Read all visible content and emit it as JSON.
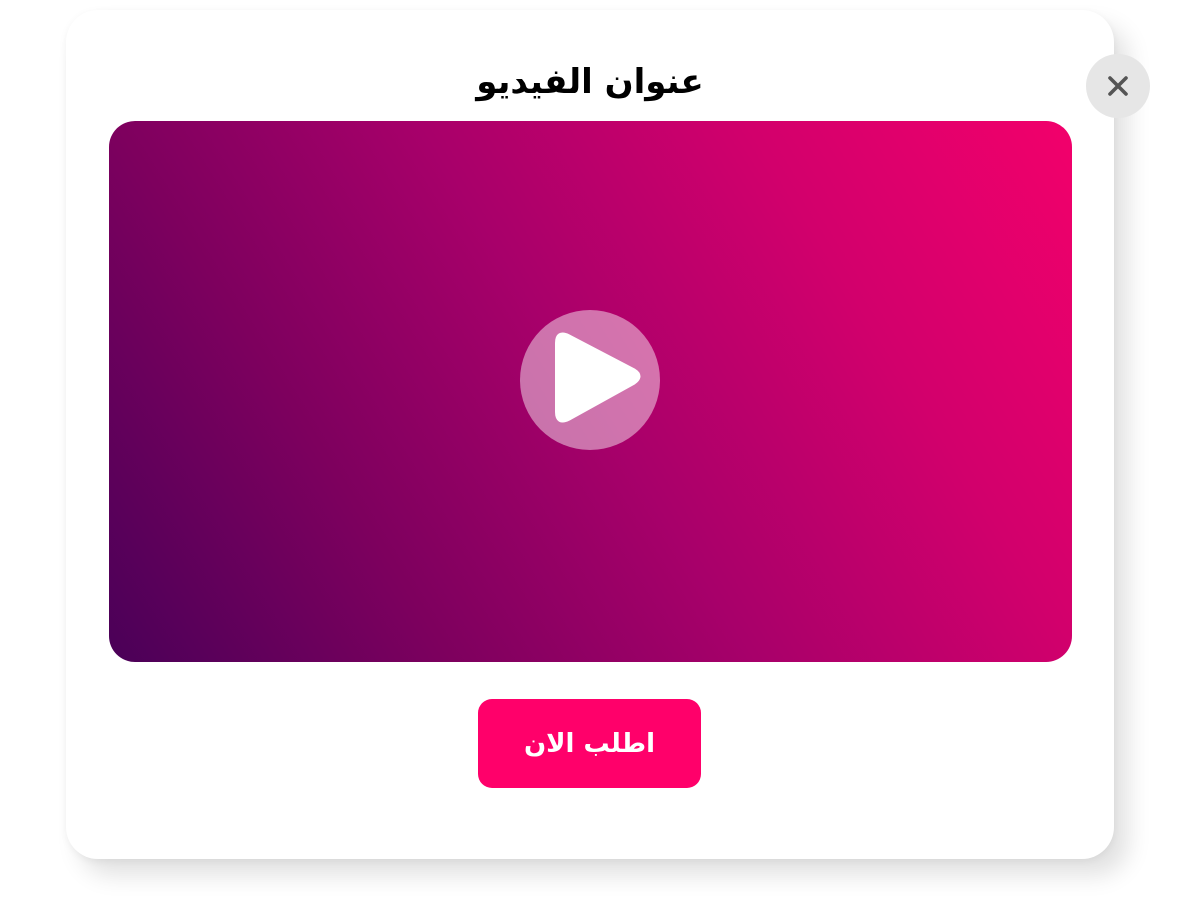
{
  "modal": {
    "title": "عنوان الفيديو",
    "close_icon": "close-icon",
    "video": {
      "play_icon": "play-icon",
      "gradient_colors": [
        "#4a0058",
        "#a8006a",
        "#f2006b"
      ]
    },
    "cta_label": "اطلب الان",
    "colors": {
      "cta_background": "#ff006a",
      "close_background": "#e6e6e6",
      "close_glyph": "#555555"
    }
  }
}
